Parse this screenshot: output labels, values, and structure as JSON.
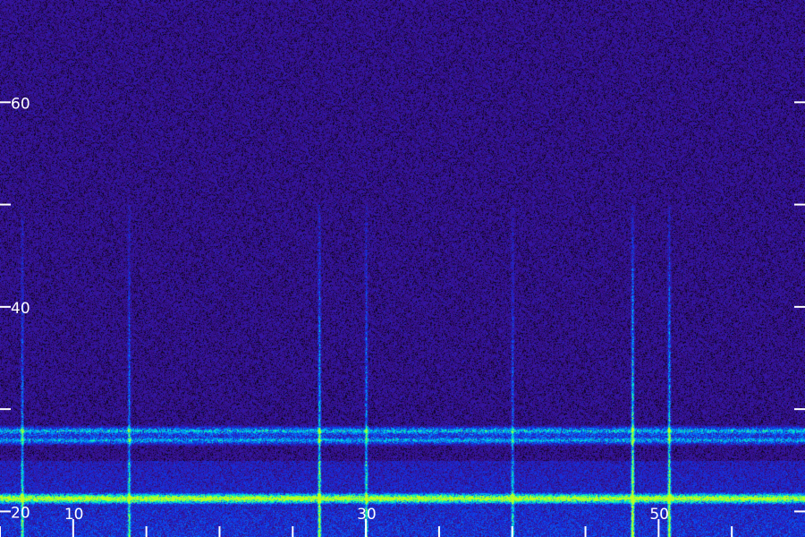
{
  "chart_data": {
    "type": "heatmap",
    "title": "",
    "xlabel": "",
    "ylabel": "",
    "xlim": [
      5,
      60
    ],
    "ylim": [
      17.5,
      70
    ],
    "x_ticks": [
      {
        "value": 10,
        "label": "10"
      },
      {
        "value": 30,
        "label": "30"
      },
      {
        "value": 50,
        "label": "50"
      }
    ],
    "x_minor_ticks": [
      5,
      15,
      20,
      25,
      35,
      40,
      45,
      55
    ],
    "y_ticks": [
      {
        "value": 20,
        "label": "20"
      },
      {
        "value": 40,
        "label": "40"
      },
      {
        "value": 60,
        "label": "60"
      }
    ],
    "y_minor_ticks": [
      30,
      50
    ],
    "grid": false,
    "colormap": [
      "#000000",
      "#2a0a5e",
      "#3a14a0",
      "#1030e0",
      "#00a0ff",
      "#00ffb0",
      "#c0ff20"
    ],
    "background_color": "#3a1480",
    "horizontal_bands": [
      {
        "y": 21.3,
        "intensity": 0.95
      },
      {
        "y": 27.9,
        "intensity": 0.6
      },
      {
        "y": 27.0,
        "intensity": 0.55
      }
    ],
    "vertical_lines": [
      {
        "x": 6.5,
        "intensity": 0.6
      },
      {
        "x": 13.8,
        "intensity": 0.55
      },
      {
        "x": 26.8,
        "intensity": 0.8
      },
      {
        "x": 30.0,
        "intensity": 0.6
      },
      {
        "x": 40.0,
        "intensity": 0.5
      },
      {
        "x": 48.2,
        "intensity": 0.95
      },
      {
        "x": 50.7,
        "intensity": 0.8
      }
    ]
  }
}
